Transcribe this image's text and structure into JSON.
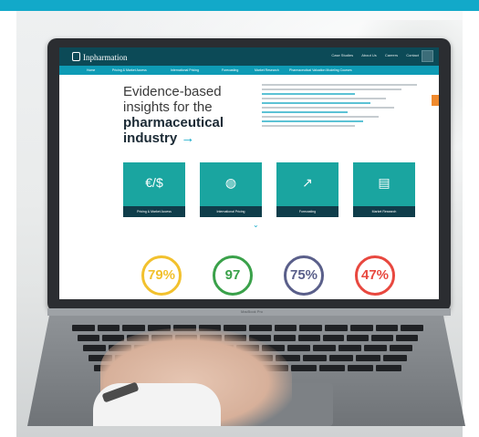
{
  "site": {
    "logo": "Inpharmation",
    "util_links": [
      "Case Studies",
      "About Us",
      "Careers",
      "Contact"
    ],
    "nav": [
      "Home",
      "Pricing & Market Access",
      "International Pricing",
      "Forecasting",
      "Market Research",
      "Pharmaceutical Valuation Modeling Courses"
    ]
  },
  "hero": {
    "line1": "Evidence-based",
    "line2": "insights for the",
    "line3": "pharmaceutical",
    "line4": "industry"
  },
  "tiles": [
    {
      "icon": "€/$",
      "label": "Pricing & Market Access"
    },
    {
      "icon": "◍",
      "label": "International Pricing"
    },
    {
      "icon": "↗",
      "label": "Forecasting"
    },
    {
      "icon": "▤",
      "label": "Market Research"
    }
  ],
  "stats": [
    {
      "value": "79%",
      "color": "#f2c12e"
    },
    {
      "value": "97",
      "color": "#3aa14a"
    },
    {
      "value": "75%",
      "color": "#5a5f8a"
    },
    {
      "value": "47%",
      "color": "#e8483f"
    }
  ],
  "laptop": {
    "model": "MacBook Pro"
  },
  "colors": {
    "band": "#12a9c9",
    "header": "#0c4a57",
    "nav": "#0e9bb5",
    "tile": "#1aa5a0"
  }
}
